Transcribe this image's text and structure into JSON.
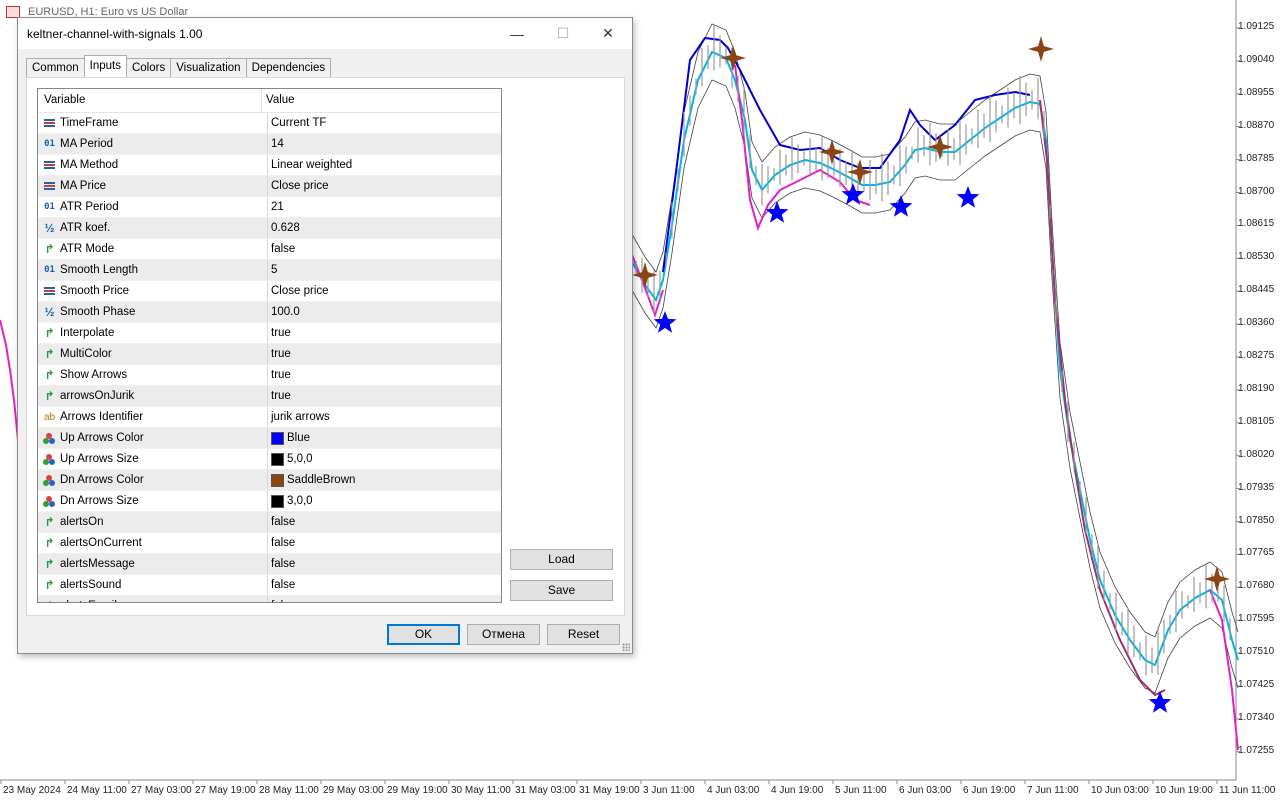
{
  "chart": {
    "title": "EURUSD, H1:  Euro vs US Dollar",
    "price_axis": [
      "1.09125",
      "1.09040",
      "1.08955",
      "1.08870",
      "1.08785",
      "1.08700",
      "1.08615",
      "1.08530",
      "1.08445",
      "1.08360",
      "1.08275",
      "1.08190",
      "1.08105",
      "1.08020",
      "1.07935",
      "1.07850",
      "1.07765",
      "1.07680",
      "1.07595",
      "1.07510",
      "1.07425",
      "1.07340",
      "1.07255"
    ],
    "time_axis": [
      "23 May 2024",
      "24 May 11:00",
      "27 May 03:00",
      "27 May 19:00",
      "28 May 11:00",
      "29 May 03:00",
      "29 May 19:00",
      "30 May 11:00",
      "31 May 03:00",
      "31 May 19:00",
      "3 Jun 11:00",
      "4 Jun 03:00",
      "4 Jun 19:00",
      "5 Jun 11:00",
      "6 Jun 03:00",
      "6 Jun 19:00",
      "7 Jun 11:00",
      "10 Jun 03:00",
      "10 Jun 19:00",
      "11 Jun 11:00"
    ],
    "colors": {
      "up_line": "#0000cc",
      "mid_line": "#00b4e6",
      "dn_line": "#e020c8",
      "dn_line_dark": "#a0306e",
      "up_arrow": "#0000ff",
      "dn_arrow": "#8b4513",
      "bands": "#404040"
    }
  },
  "dialog": {
    "title": "keltner-channel-with-signals 1.00",
    "window_buttons": {
      "minimize": "—",
      "maximize": "☐",
      "close": "✕"
    },
    "tabs": [
      {
        "label": "Common",
        "active": false
      },
      {
        "label": "Inputs",
        "active": true
      },
      {
        "label": "Colors",
        "active": false
      },
      {
        "label": "Visualization",
        "active": false
      },
      {
        "label": "Dependencies",
        "active": false
      }
    ],
    "grid": {
      "headers": {
        "variable": "Variable",
        "value": "Value"
      },
      "rows": [
        {
          "name": "TimeFrame",
          "value": "Current TF",
          "type": "enum"
        },
        {
          "name": "MA Period",
          "value": "14",
          "type": "int"
        },
        {
          "name": "MA Method",
          "value": "Linear weighted",
          "type": "enum"
        },
        {
          "name": "MA Price",
          "value": "Close price",
          "type": "enum"
        },
        {
          "name": "ATR Period",
          "value": "21",
          "type": "int"
        },
        {
          "name": "ATR koef.",
          "value": "0.628",
          "type": "double"
        },
        {
          "name": "ATR Mode",
          "value": "false",
          "type": "bool"
        },
        {
          "name": "Smooth Length",
          "value": "5",
          "type": "int"
        },
        {
          "name": "Smooth Price",
          "value": "Close price",
          "type": "enum"
        },
        {
          "name": "Smooth Phase",
          "value": "100.0",
          "type": "double"
        },
        {
          "name": "Interpolate",
          "value": "true",
          "type": "bool"
        },
        {
          "name": "MultiColor",
          "value": "true",
          "type": "bool"
        },
        {
          "name": "Show Arrows",
          "value": "true",
          "type": "bool"
        },
        {
          "name": "arrowsOnJurik",
          "value": "true",
          "type": "bool"
        },
        {
          "name": "Arrows Identifier",
          "value": "jurik arrows",
          "type": "string"
        },
        {
          "name": "Up Arrows Color",
          "value": "Blue",
          "type": "color",
          "swatch": "#0000ff"
        },
        {
          "name": "Up Arrows Size",
          "value": "5,0,0",
          "type": "color",
          "swatch": "#000000"
        },
        {
          "name": "Dn Arrows Color",
          "value": "SaddleBrown",
          "type": "color",
          "swatch": "#8b4513"
        },
        {
          "name": "Dn Arrows Size",
          "value": "3,0,0",
          "type": "color",
          "swatch": "#000000"
        },
        {
          "name": "alertsOn",
          "value": "false",
          "type": "bool"
        },
        {
          "name": "alertsOnCurrent",
          "value": "false",
          "type": "bool"
        },
        {
          "name": "alertsMessage",
          "value": "false",
          "type": "bool"
        },
        {
          "name": "alertsSound",
          "value": "false",
          "type": "bool"
        },
        {
          "name": "alertsEmail",
          "value": "false",
          "type": "bool"
        }
      ]
    },
    "buttons": {
      "load": "Load",
      "save": "Save",
      "ok": "OK",
      "cancel": "Отмена",
      "reset": "Reset"
    }
  }
}
